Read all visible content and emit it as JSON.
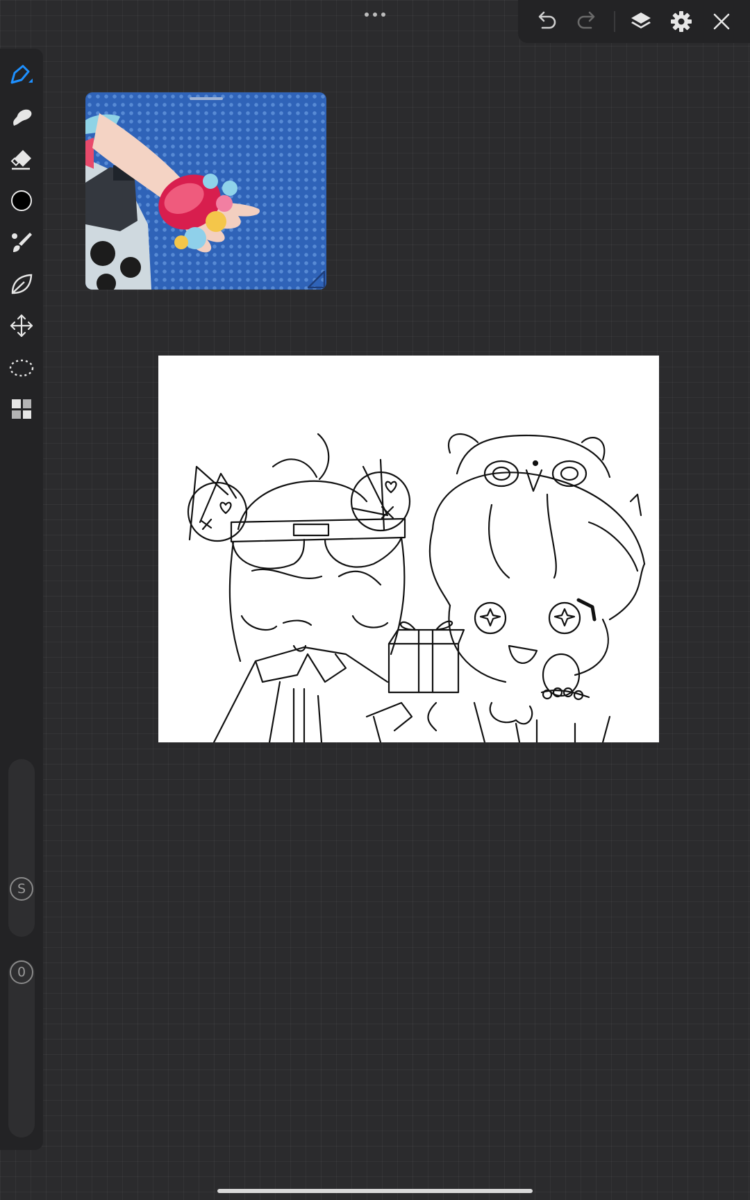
{
  "app": {
    "accent_color": "#1e90ff",
    "background_color": "#2b2b2d",
    "panel_color": "#232325"
  },
  "top_toolbar": {
    "buttons": [
      {
        "icon": "undo-icon"
      },
      {
        "icon": "redo-icon",
        "enabled": false
      },
      {
        "icon": "layers-icon"
      },
      {
        "icon": "gear-icon"
      },
      {
        "icon": "close-icon"
      }
    ]
  },
  "left_toolbar": {
    "tools": [
      {
        "icon": "pen-icon",
        "selected": true
      },
      {
        "icon": "smudge-blob-icon"
      },
      {
        "icon": "eraser-icon"
      },
      {
        "icon": "color-swatch",
        "color": "#000000"
      },
      {
        "icon": "fill-brush-icon"
      },
      {
        "icon": "liquify-leaf-icon"
      },
      {
        "icon": "move-arrows-icon"
      },
      {
        "icon": "lasso-selection-icon"
      },
      {
        "icon": "grid-panels-icon"
      }
    ],
    "size_badge": "S",
    "opacity_badge": "0"
  },
  "reference_window": {
    "description_icon": "reference-image"
  }
}
